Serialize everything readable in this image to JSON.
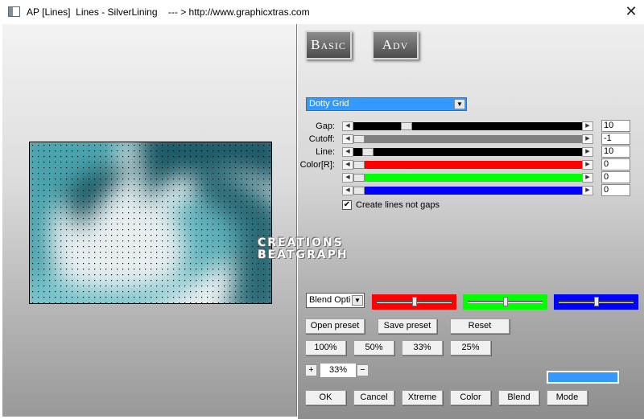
{
  "window": {
    "title": "AP [Lines]  Lines - SilverLining    --- > http://www.graphicxtras.com"
  },
  "tabs": [
    {
      "label": "Basic"
    },
    {
      "label": "Adv"
    }
  ],
  "preset_select": {
    "value": "Dotty Grid"
  },
  "params": {
    "gap": {
      "label": "Gap:",
      "value": "10",
      "fraction": 0.22
    },
    "cutoff": {
      "label": "Cutoff:",
      "value": "-1",
      "fraction": 0.0
    },
    "line": {
      "label": "Line:",
      "value": "10",
      "fraction": 0.04
    },
    "color_label": "Color[R]:",
    "red": {
      "value": "0",
      "fraction": 0.0
    },
    "green": {
      "value": "0",
      "fraction": 0.0
    },
    "blue": {
      "value": "0",
      "fraction": 0.0
    }
  },
  "create_lines": {
    "label": "Create lines not gaps",
    "checked": true
  },
  "watermark": {
    "line1": "CREATIONS",
    "line2": "BEATGRAPH"
  },
  "blend": {
    "value": "Blend Options",
    "red_level": 0.5,
    "green_level": 0.5,
    "blue_level": 0.5
  },
  "preset_buttons": {
    "open": "Open preset",
    "save": "Save preset",
    "reset": "Reset"
  },
  "zoom_buttons": [
    "100%",
    "50%",
    "33%",
    "25%"
  ],
  "zoom": {
    "plus": "+",
    "minus": "−",
    "value": "33%"
  },
  "colors": {
    "highlight": "#3399ff",
    "red": "#ff0000",
    "green": "#00ff00",
    "blue": "#0000ff",
    "preview_teal": "#1e5a66"
  },
  "bottom_buttons": {
    "ok": "OK",
    "cancel": "Cancel",
    "xtreme": "Xtreme",
    "color": "Color",
    "blend": "Blend",
    "mode": "Mode"
  }
}
